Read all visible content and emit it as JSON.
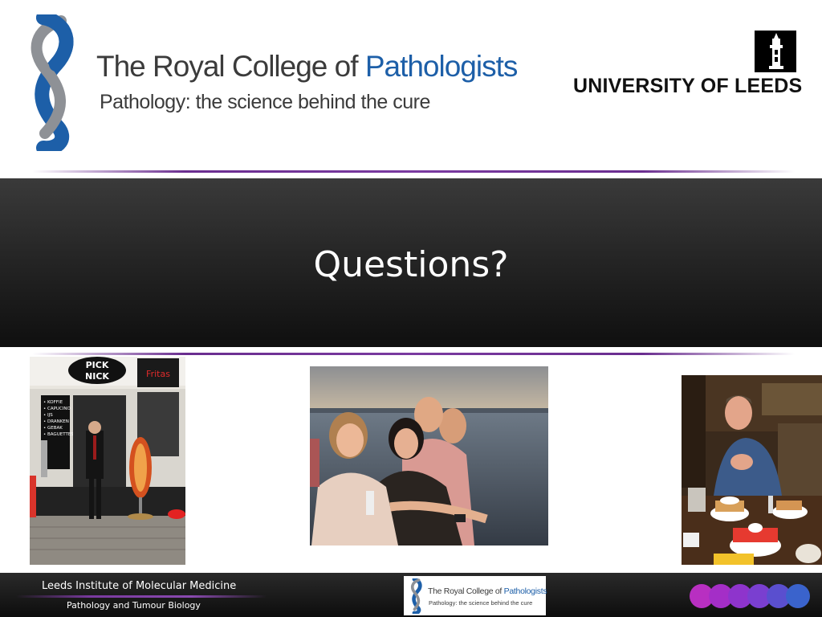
{
  "header": {
    "rcp_title_main": "The Royal College of ",
    "rcp_title_accent": "Pathologists",
    "rcp_subtitle": "Pathology: the science behind the cure",
    "leeds_name": "UNIVERSITY OF LEEDS"
  },
  "slide": {
    "title": "Questions?"
  },
  "photos": {
    "left_sign": "PICK NICK",
    "left_sign_right": "Fritas",
    "left_menu": [
      "KOFFIE",
      "CAPUCINO",
      "IJS",
      "DRANKEN",
      "GEBAK",
      "BAGUETTES"
    ]
  },
  "footer": {
    "institute": "Leeds Institute of Molecular Medicine",
    "department": "Pathology and Tumour Biology",
    "logo_title_main": "The Royal College of ",
    "logo_title_accent": "Pathologists",
    "logo_subtitle": "Pathology: the science behind the cure"
  },
  "colors": {
    "rcp_blue": "#1d5fa8",
    "rcp_grey": "#8e9196",
    "purple_rule": "#6a2d8f"
  }
}
